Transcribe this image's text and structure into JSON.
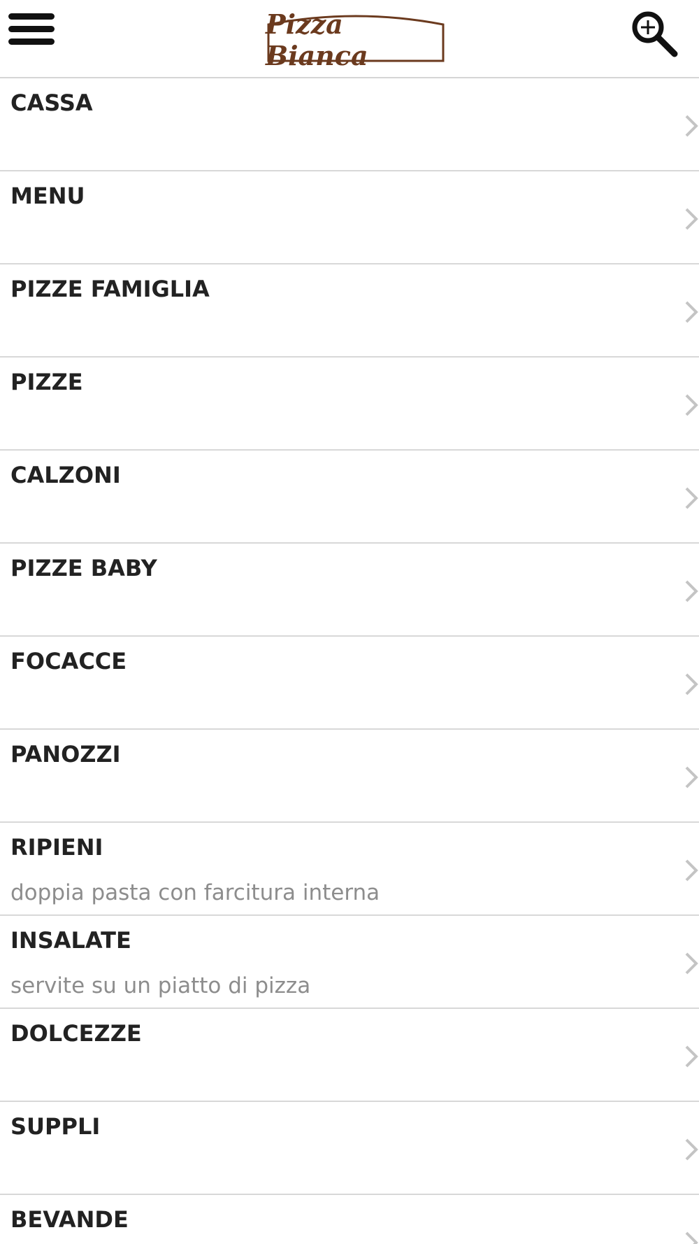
{
  "header": {
    "logo_text": "Pizza Bianca",
    "menu_icon": "hamburger-menu-icon",
    "search_icon": "zoom-in-search-icon",
    "logo_color": "#6b3a1e"
  },
  "categories": [
    {
      "label": "CASSA",
      "subtitle": ""
    },
    {
      "label": "MENU",
      "subtitle": ""
    },
    {
      "label": "PIZZE FAMIGLIA",
      "subtitle": ""
    },
    {
      "label": "PIZZE",
      "subtitle": ""
    },
    {
      "label": "CALZONI",
      "subtitle": ""
    },
    {
      "label": "PIZZE BABY",
      "subtitle": ""
    },
    {
      "label": "FOCACCE",
      "subtitle": ""
    },
    {
      "label": "PANOZZI",
      "subtitle": ""
    },
    {
      "label": "RIPIENI",
      "subtitle": "doppia pasta con farcitura interna"
    },
    {
      "label": "INSALATE",
      "subtitle": "servite su un piatto di pizza"
    },
    {
      "label": "DOLCEZZE",
      "subtitle": ""
    },
    {
      "label": "SUPPLI",
      "subtitle": ""
    },
    {
      "label": "BEVANDE",
      "subtitle": ""
    }
  ],
  "colors": {
    "title_text": "#222222",
    "subtitle_text": "#8d8d8d",
    "divider": "#d8d8d8",
    "chevron": "#c4c4c4"
  }
}
